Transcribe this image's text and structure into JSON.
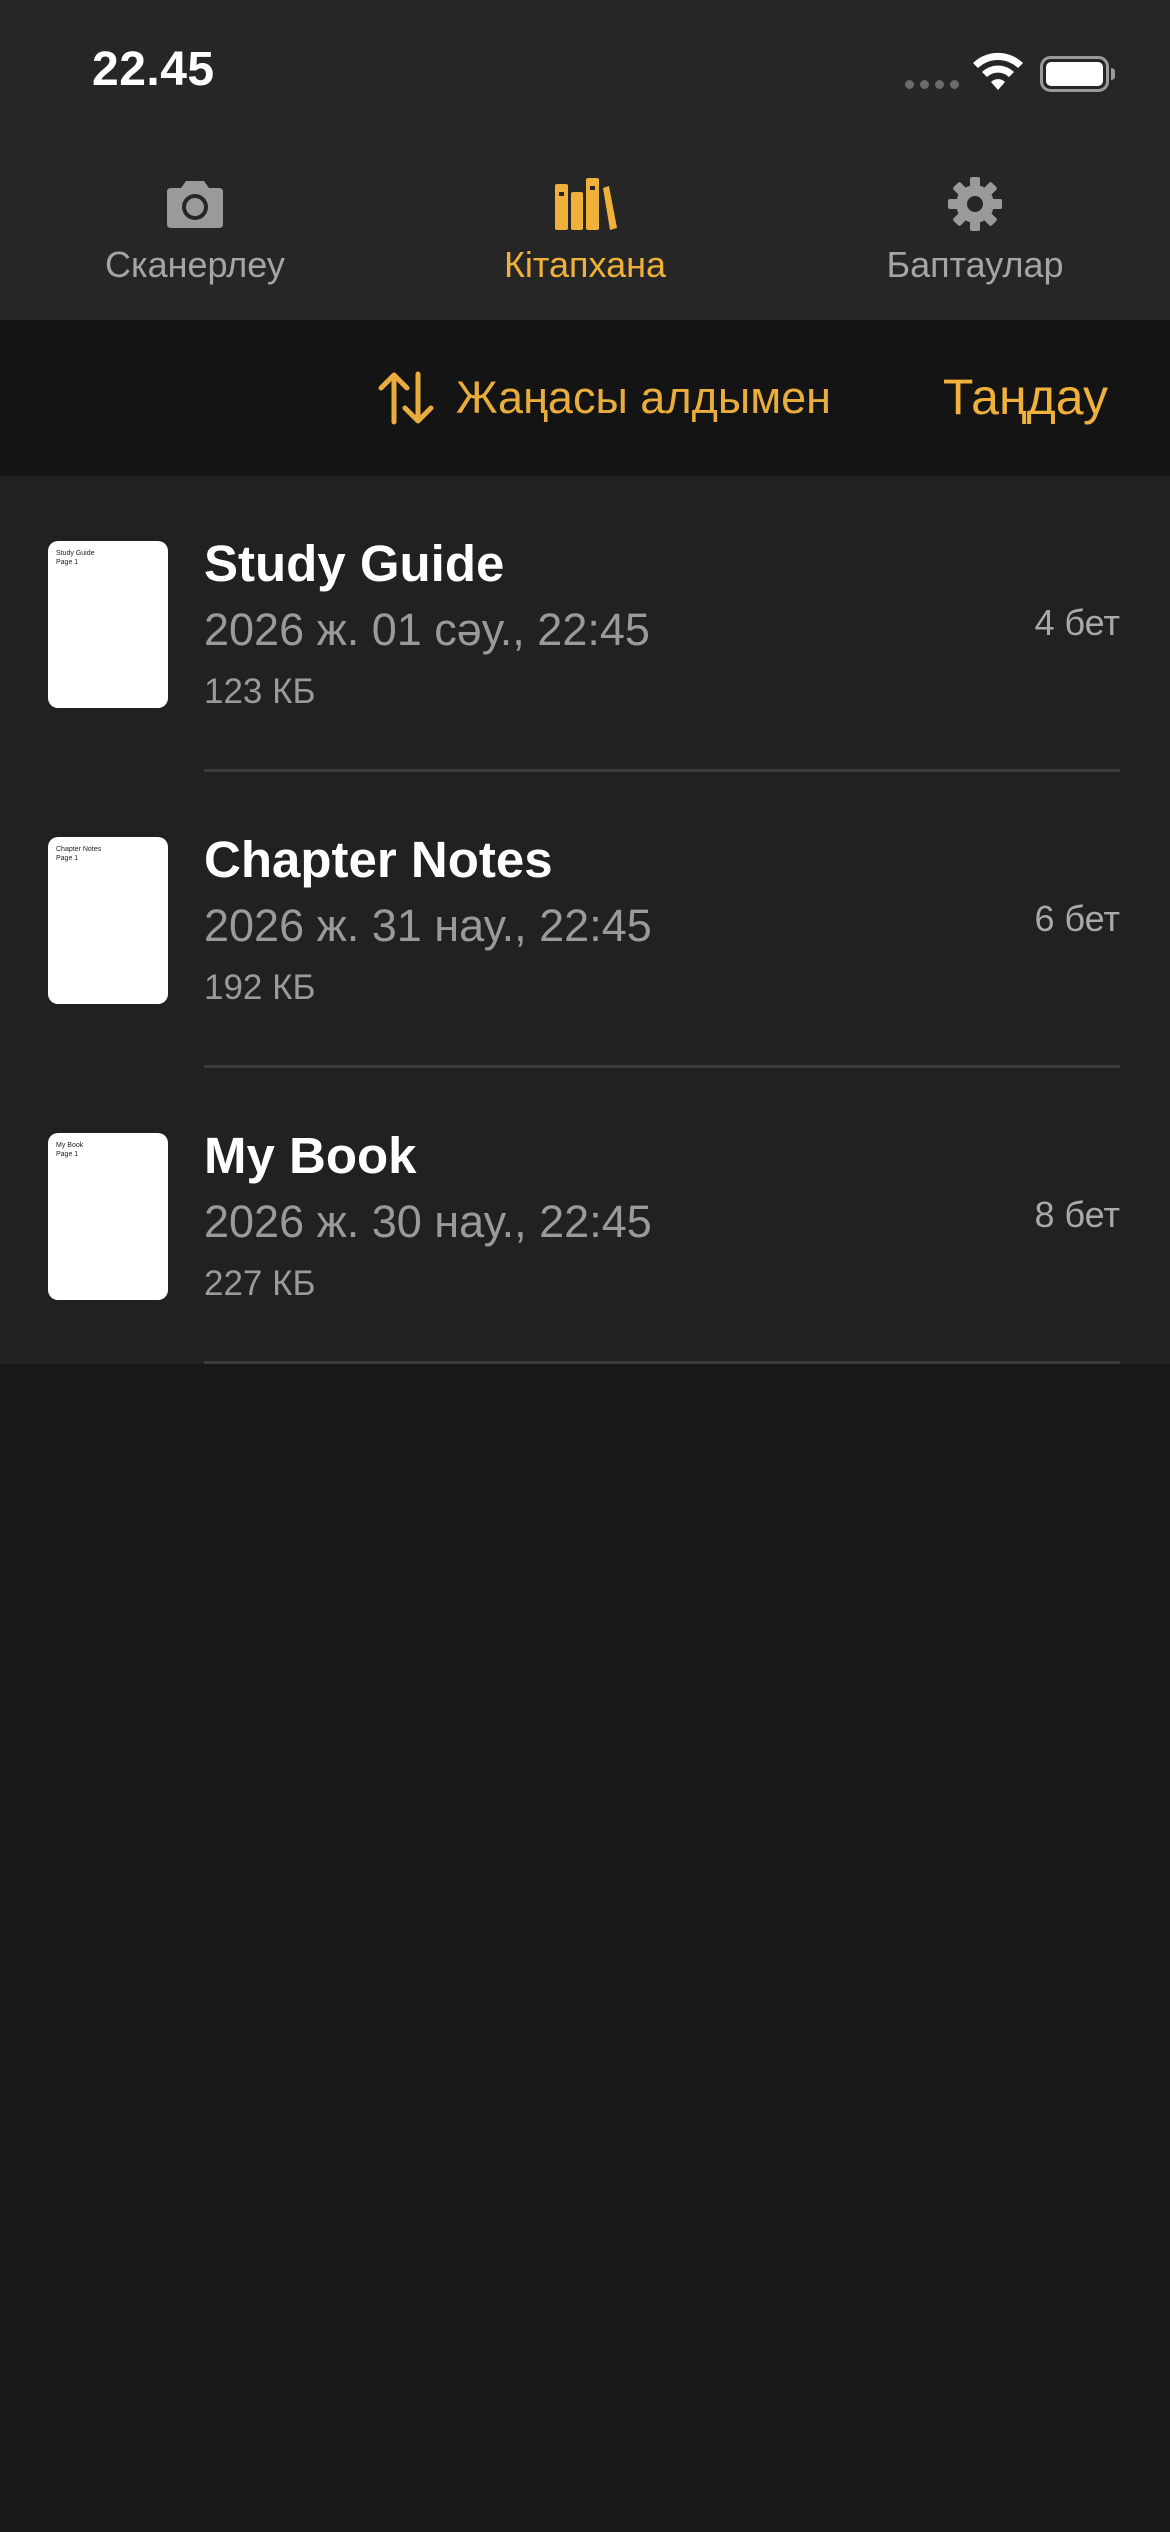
{
  "status_bar": {
    "time": "22.45"
  },
  "tabs": [
    {
      "label": "Сканерлеу",
      "icon": "camera-icon",
      "active": false
    },
    {
      "label": "Кітапхана",
      "icon": "books-icon",
      "active": true
    },
    {
      "label": "Баптаулар",
      "icon": "gear-icon",
      "active": false
    }
  ],
  "toolbar": {
    "sort_label": "Жаңасы алдымен",
    "sort_icon": "sort-arrows-icon",
    "select_label": "Таңдау"
  },
  "documents": [
    {
      "title": "Study Guide",
      "date": "2026 ж. 01 сәу., 22:45",
      "size": "123 КБ",
      "pages": "4 бет",
      "thumb_text": "Study Guide\nPage 1"
    },
    {
      "title": "Chapter Notes",
      "date": "2026 ж. 31 нау., 22:45",
      "size": "192 КБ",
      "pages": "6 бет",
      "thumb_text": "Chapter Notes\nPage 1"
    },
    {
      "title": "My Book",
      "date": "2026 ж. 30 нау., 22:45",
      "size": "227 КБ",
      "pages": "8 бет",
      "thumb_text": "My Book\nPage 1"
    }
  ],
  "colors": {
    "accent": "#f0b13a",
    "background": "#181818",
    "bar_background": "#262626",
    "list_background": "#212121"
  }
}
